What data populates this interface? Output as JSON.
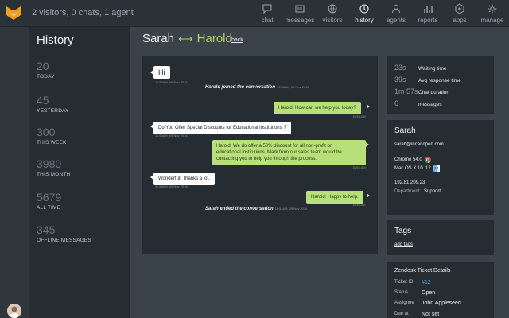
{
  "topbar": {
    "status": "2 visitors, 0 chats, 1 agent",
    "nav": [
      {
        "label": "chat",
        "icon": "chat-icon"
      },
      {
        "label": "messages",
        "icon": "messages-icon"
      },
      {
        "label": "visitors",
        "icon": "visitors-icon"
      },
      {
        "label": "history",
        "icon": "history-icon"
      },
      {
        "label": "agents",
        "icon": "agents-icon"
      },
      {
        "label": "reports",
        "icon": "reports-icon"
      },
      {
        "label": "apps",
        "icon": "apps-icon"
      },
      {
        "label": "manage",
        "icon": "manage-icon"
      }
    ],
    "active": "history"
  },
  "history": {
    "title": "History",
    "stats": [
      {
        "value": "20",
        "label": "TODAY"
      },
      {
        "value": "45",
        "label": "YESTERDAY"
      },
      {
        "value": "300",
        "label": "THIS WEEK"
      },
      {
        "value": "3980",
        "label": "THIS MONTH"
      },
      {
        "value": "5679",
        "label": "ALL TIME"
      },
      {
        "value": "345",
        "label": "OFFLINE MESSAGES"
      }
    ]
  },
  "chat": {
    "visitor": "Sarah",
    "agent": "Harold",
    "arrow": "⟷",
    "back": "back",
    "messages": [
      {
        "type": "w",
        "text": "Hi",
        "time": "11:53AM, 09 Nov 2016"
      },
      {
        "type": "sys",
        "text": "Harold joined the conversation",
        "time": "11:53AM, 09 Nov 2016"
      },
      {
        "type": "g",
        "text": "Harold: How can we help you today?",
        "time": "11:53 AM"
      },
      {
        "type": "w",
        "text": "Do You Offer Special Discounts for Educational Institutions ?",
        "time": "11:53AM, 09 Nov 2016"
      },
      {
        "type": "g",
        "lines": [
          "Harold: We do offer a 50% discount for all non-profit or",
          "educational institutions. Mark from our sales team would be",
          "contacting you to help you through the process."
        ],
        "time": "11:54 AM"
      },
      {
        "type": "w",
        "text": "Wonderful! Thanks a lot.",
        "time": "11:54AM, 09 Nov 2016"
      },
      {
        "type": "g",
        "text": "Harold: Happy to help.",
        "time": "11:54 AM"
      },
      {
        "type": "sys",
        "text": "Sarah ended the conversation",
        "time": "11:54AM, 09 Nov 2016"
      }
    ]
  },
  "metrics": [
    {
      "value": "23s",
      "label": "Waiting time"
    },
    {
      "value": "39s",
      "label": "Avg response time"
    },
    {
      "value": "1m 57s",
      "label": "Chat duration"
    },
    {
      "value": "6",
      "label": "messages"
    }
  ],
  "visitor": {
    "name": "Sarah",
    "email": "sarah@incandpen.com",
    "browser": "Chrome 54.0",
    "os": "Mac OS X 10 .12",
    "ip": "192.81.209.23",
    "department_key": "Department:",
    "department": "Support"
  },
  "tags": {
    "title": "Tags",
    "add": "add tags"
  },
  "zendesk": {
    "title": "Zendesk Ticket Details",
    "rows": [
      {
        "key": "Ticket ID",
        "value": "#12"
      },
      {
        "key": "Status",
        "value": "Open"
      },
      {
        "key": "Assignee",
        "value": "John Appleseed"
      },
      {
        "key": "Due at",
        "value": "Not set"
      }
    ]
  },
  "colors": {
    "accent": "#b3d06a",
    "bubble_green": "#b8e07a",
    "logo": "#f39c1f",
    "link": "#58a8d8"
  }
}
